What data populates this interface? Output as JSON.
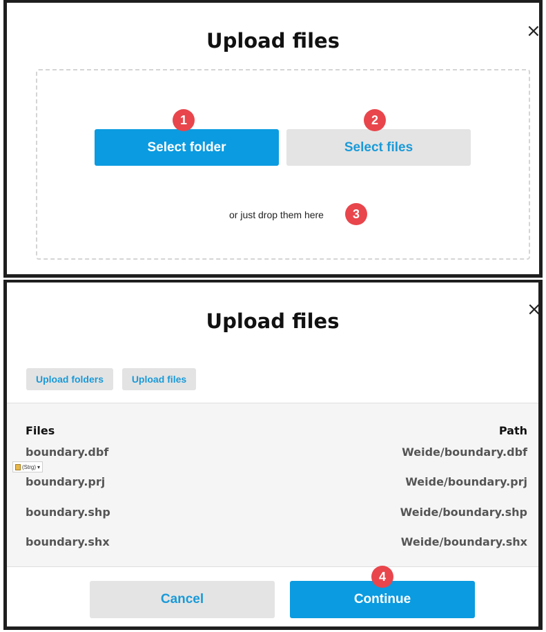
{
  "dialog1": {
    "title": "Upload files",
    "close_glyph": "×",
    "select_folder_label": "Select folder",
    "select_files_label": "Select files",
    "drop_text": "or just drop them here",
    "badges": [
      "1",
      "2",
      "3"
    ]
  },
  "dialog2": {
    "title": "Upload files",
    "close_glyph": "×",
    "upload_folders_label": "Upload folders",
    "upload_files_label": "Upload files",
    "files_header": "Files",
    "path_header": "Path",
    "rows": [
      {
        "name": "boundary.dbf",
        "path": "Weide/boundary.dbf"
      },
      {
        "name": "boundary.prj",
        "path": "Weide/boundary.prj"
      },
      {
        "name": "boundary.shp",
        "path": "Weide/boundary.shp"
      },
      {
        "name": "boundary.shx",
        "path": "Weide/boundary.shx"
      }
    ],
    "paste_tag": "(Strg)",
    "paste_icon": "clipboard-icon",
    "cancel_label": "Cancel",
    "continue_label": "Continue",
    "badge": "4"
  },
  "colors": {
    "primary": "#0b9be0",
    "secondary_bg": "#e4e4e4",
    "link_text": "#1a9ad8",
    "badge": "#e8464c"
  }
}
